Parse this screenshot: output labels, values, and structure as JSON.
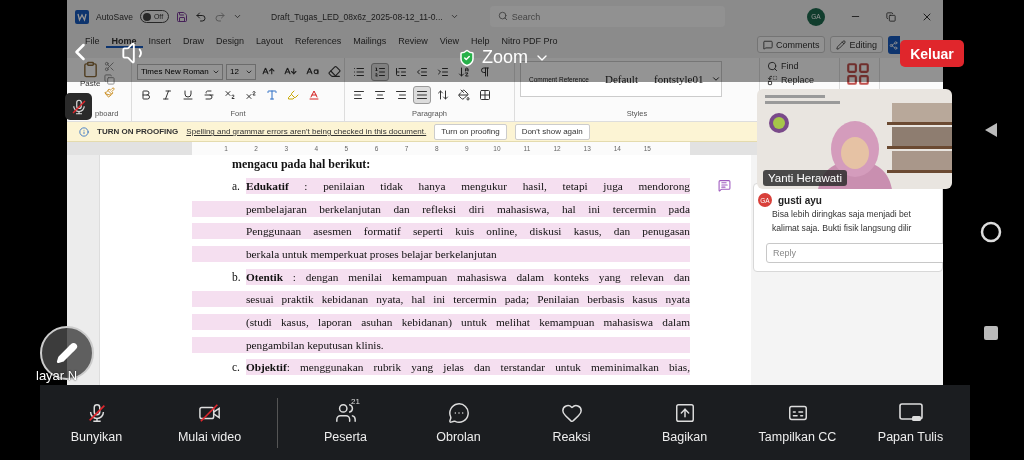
{
  "zoom": {
    "title": "Zoom",
    "leave_button": "Keluar",
    "self_muted": true,
    "annotate_label": "layar N"
  },
  "word": {
    "titlebar": {
      "autosave": "AutoSave",
      "autosave_state": "Off",
      "autosave_on": false,
      "document": "Draft_Tugas_LED_08x6z_2025-08-12_11-0...",
      "search_placeholder": "Search",
      "avatar": "GA"
    },
    "tabs": [
      {
        "label": "File",
        "selected": false
      },
      {
        "label": "Home",
        "selected": true
      },
      {
        "label": "Insert",
        "selected": false
      },
      {
        "label": "Draw",
        "selected": false
      },
      {
        "label": "Design",
        "selected": false
      },
      {
        "label": "Layout",
        "selected": false
      },
      {
        "label": "References",
        "selected": false
      },
      {
        "label": "Mailings",
        "selected": false
      },
      {
        "label": "Review",
        "selected": false
      },
      {
        "label": "View",
        "selected": false
      },
      {
        "label": "Help",
        "selected": false
      },
      {
        "label": "Nitro PDF Pro",
        "selected": false
      }
    ],
    "header_buttons": [
      {
        "kind": "comments",
        "label": "Comments"
      },
      {
        "kind": "editing",
        "label": "Editing"
      }
    ],
    "ribbon": {
      "paste": "Paste",
      "font": "Times New Roman",
      "font_size": "12",
      "font_size_tools": [
        {
          "kind": "grow"
        },
        {
          "kind": "shrink"
        },
        {
          "kind": "change_case"
        },
        {
          "kind": "clear"
        }
      ],
      "font_tools": [
        {
          "kind": "bold"
        },
        {
          "kind": "italic"
        },
        {
          "kind": "underline"
        },
        {
          "kind": "strikethrough"
        },
        {
          "kind": "subscript"
        },
        {
          "kind": "superscript"
        },
        {
          "kind": "text_effects"
        },
        {
          "kind": "highlight"
        },
        {
          "kind": "font_color"
        }
      ],
      "paragraph_rows": [
        [
          {
            "kind": "bullets",
            "selected": false
          },
          {
            "kind": "numbering",
            "selected": true
          },
          {
            "kind": "multilevel",
            "selected": false
          },
          {
            "kind": "outdent",
            "selected": false
          },
          {
            "kind": "indent",
            "selected": false
          },
          {
            "kind": "sort",
            "selected": false
          },
          {
            "kind": "marks",
            "selected": false
          }
        ],
        [
          {
            "kind": "align_left",
            "selected": false
          },
          {
            "kind": "align_center",
            "selected": false
          },
          {
            "kind": "align_right",
            "selected": false
          },
          {
            "kind": "justify",
            "selected": true
          },
          {
            "kind": "line_spacing",
            "selected": false
          },
          {
            "kind": "shading",
            "selected": false
          },
          {
            "kind": "borders",
            "selected": false
          }
        ]
      ],
      "styles": [
        "Comment Reference",
        "Default",
        "fontstyle01"
      ],
      "find": "Find",
      "replace": "Replace",
      "groups": [
        "pboard",
        "Font",
        "Paragraph",
        "Styles"
      ]
    },
    "proofing": {
      "title": "TURN ON PROOFING",
      "message": "Spelling and grammar errors aren't being checked in this document.",
      "buttons": [
        "Turn on proofing",
        "Don't show again"
      ]
    },
    "ruler": [
      "1",
      "2",
      "3",
      "4",
      "5",
      "6",
      "7",
      "8",
      "9",
      "10",
      "11",
      "12",
      "13",
      "14",
      "15"
    ],
    "document": {
      "heading": "mengacu pada hal berikut:",
      "items": [
        {
          "marker": "a.",
          "highlighted": true,
          "has_comment": true,
          "lines": [
            "**Edukatif** : penilaian tidak hanya mengukur hasil, tetapi juga mendorong",
            "pembelajaran berkelanjutan dan refleksi diri mahasiswa, hal ini tercermin pada",
            "Penggunaan asesmen formatif seperti kuis online, diskusi kasus, dan penugasan",
            "berkala untuk memperkuat proses belajar berkelanjutan"
          ]
        },
        {
          "marker": "b.",
          "highlighted": true,
          "has_comment": false,
          "lines": [
            "**Otentik** : dengan menilai kemampuan mahasiswa dalam konteks yang relevan dan",
            "sesuai praktik kebidanan nyata, hal ini tercermin pada; Penilaian berbasis kasus nyata",
            "(studi kasus, laporan asuhan kebidanan) untuk melihat kemampuan mahasiswa dalam",
            "pengambilan keputusan klinis."
          ]
        },
        {
          "marker": "c.",
          "highlighted": true,
          "has_comment": false,
          "lines": [
            "**Objektif**: menggunakan rubrik yang jelas dan terstandar untuk meminimalkan bias,"
          ]
        }
      ]
    },
    "comment": {
      "avatar": "GA",
      "author": "gusti ayu",
      "lines": [
        "Bisa lebih diringkas saja menjadi bet",
        "kalimat saja. Bukti fisik langsung dilir"
      ],
      "reply_placeholder": "Reply"
    }
  },
  "video": {
    "name": "Yanti Herawati"
  },
  "toolbar": [
    {
      "kind": "mic_off",
      "label": "Bunyikan"
    },
    {
      "kind": "video_off",
      "label": "Mulai video"
    },
    {
      "kind": "participants",
      "label": "Peserta",
      "badge": "21"
    },
    {
      "kind": "chat",
      "label": "Obrolan"
    },
    {
      "kind": "reactions",
      "label": "Reaksi"
    },
    {
      "kind": "share",
      "label": "Bagikan"
    },
    {
      "kind": "captions",
      "label": "Tampilkan CC"
    },
    {
      "kind": "whiteboard",
      "label": "Papan Tulis"
    }
  ]
}
